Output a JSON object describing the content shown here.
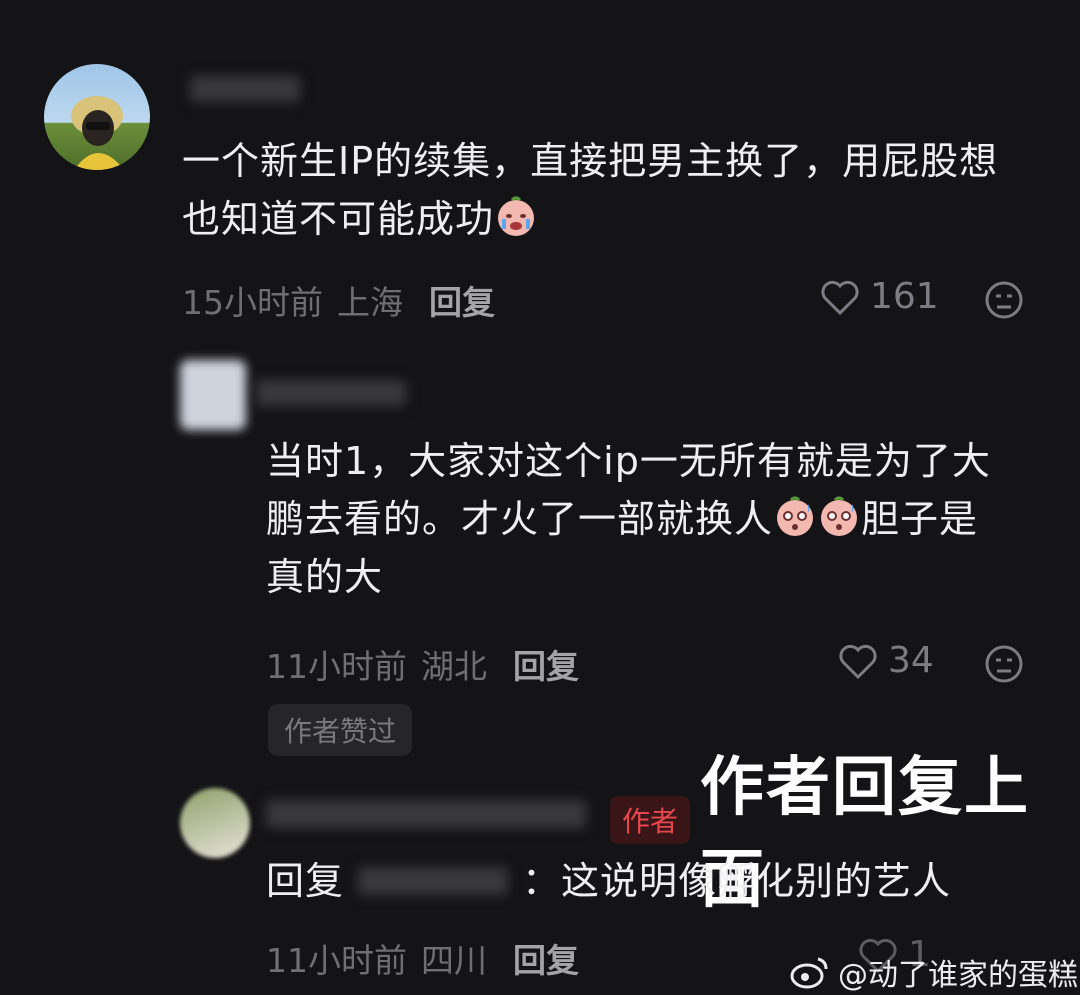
{
  "comments": [
    {
      "text_lines": [
        "一个新生IP的续集，直接把男主换了，用屁股想",
        "也知道不可能成功"
      ],
      "time": "15小时前",
      "location": "上海",
      "reply_label": "回复",
      "likes": "161",
      "emoji": "crying-face"
    },
    {
      "text_lines": [
        "当时1，大家对这个ip一无所有就是为了大",
        "鹏去看的。才火了一部就换人",
        "胆子是",
        "真的大"
      ],
      "time": "11小时前",
      "location": "湖北",
      "reply_label": "回复",
      "likes": "34",
      "badge": "作者赞过",
      "emoji": "sweating-face"
    },
    {
      "author_tag": "作者",
      "reply_prefix": "回复",
      "reply_text": "：这说明像孵化别的艺人",
      "time": "11小时前",
      "location": "四川",
      "reply_label": "回复",
      "likes": "1"
    }
  ],
  "overlay_caption": "作者回复上面",
  "watermark": "@动了谁家的蛋糕",
  "colors": {
    "background": "#141316",
    "author_red": "#e8464d"
  }
}
